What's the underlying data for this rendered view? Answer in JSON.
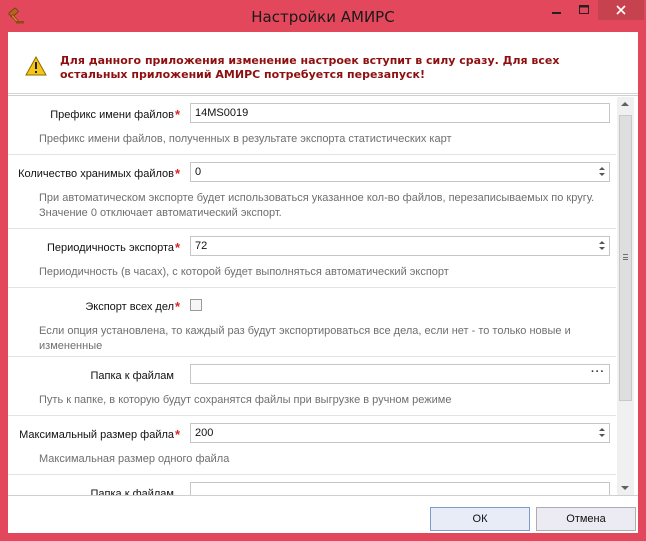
{
  "window": {
    "title": "Настройки АМИРС",
    "accent": "#e3475c",
    "close_color": "#c7424f",
    "icons": {
      "app": "gavel-icon",
      "minimize": "minimize-icon",
      "maximize": "maximize-icon",
      "close": "close-icon"
    }
  },
  "warning": {
    "icon": "warning-icon",
    "text": "Для данного приложения изменение настроек вступит в силу сразу. Для всех остальных приложений АМИРС потребуется перезапуск!",
    "text_color": "#8e0f0f"
  },
  "settings": [
    {
      "label": "Префикс имени файлов",
      "required": true,
      "type": "text",
      "value": "14MS0019",
      "description": "Префикс имени файлов, полученных в результате экспорта статистических карт"
    },
    {
      "label": "Количество хранимых файлов",
      "required": true,
      "type": "spin",
      "value": "0",
      "description": "При автоматическом экспорте будет использоваться указанное кол-во файлов, перезаписываемых по кругу. Значение 0 отключает автоматический экспорт."
    },
    {
      "label": "Периодичность экспорта",
      "required": true,
      "type": "spin",
      "value": "72",
      "description": "Периодичность (в часах), с которой будет выполняться автоматический экспорт"
    },
    {
      "label": "Экспорт всех дел",
      "required": true,
      "type": "checkbox",
      "checked": false,
      "description": "Если опция установлена, то каждый раз будут экспортироваться все дела, если нет - то только новые и измененные"
    },
    {
      "label": "Папка к файлам",
      "required": false,
      "type": "browse",
      "value": "",
      "browse_label": "···",
      "description": "Путь к папке, в которую будут сохранятся файлы при выгрузке в ручном режиме"
    },
    {
      "label": "Максимальный размер файла",
      "required": true,
      "type": "spin",
      "value": "200",
      "description": "Максимальная размер одного файла"
    },
    {
      "label": "Папка к файлам",
      "required": false,
      "type": "text",
      "value": "",
      "description": ""
    }
  ],
  "required_mark": "*",
  "buttons": {
    "ok": "ОК",
    "cancel": "Отмена"
  }
}
